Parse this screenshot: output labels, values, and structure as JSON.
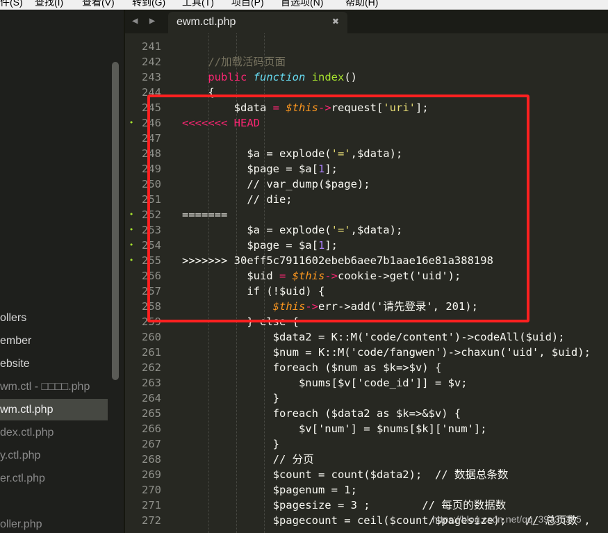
{
  "menubar": {
    "items": [
      "件(S)",
      "查找(I)",
      "查看(V)",
      "转到(G)",
      "工具(T)",
      "项目(P)",
      "首选项(N)",
      "帮助(H)"
    ]
  },
  "sidebar": {
    "items": [
      {
        "label": "ollers"
      },
      {
        "label": "ember"
      },
      {
        "label": "ebsite"
      },
      {
        "label": "wm.ctl - □□□□.php"
      },
      {
        "label": "wm.ctl.php"
      },
      {
        "label": "dex.ctl.php"
      },
      {
        "label": "y.ctl.php"
      },
      {
        "label": "er.ctl.php"
      },
      {
        "label": "oller.php"
      }
    ]
  },
  "tab": {
    "nav": "◀ ▶",
    "title": "ewm.ctl.php",
    "close": "✖"
  },
  "editor": {
    "line_numbers": [
      "241",
      "242",
      "243",
      "244",
      "245",
      "246",
      "247",
      "248",
      "249",
      "250",
      "251",
      "252",
      "253",
      "254",
      "255",
      "256",
      "257",
      "258",
      "259",
      "260",
      "261",
      "262",
      "263",
      "264",
      "265",
      "266",
      "267",
      "268",
      "269",
      "270",
      "271",
      "272"
    ],
    "modified_marks": [
      "",
      "",
      "",
      "",
      "",
      "•",
      "",
      "",
      "",
      "",
      "",
      "•",
      "•",
      "•",
      "•",
      "",
      "",
      "",
      "",
      "",
      "",
      "",
      "",
      "",
      "",
      "",
      "",
      "",
      "",
      "",
      "",
      ""
    ],
    "lines": [
      [],
      [
        [
          "c",
          "    //加载活码页面"
        ]
      ],
      [
        [
          "p",
          "    "
        ],
        [
          "k",
          "public"
        ],
        [
          "p",
          " "
        ],
        [
          "s",
          "function"
        ],
        [
          "p",
          " "
        ],
        [
          "f",
          "index"
        ],
        [
          "p",
          "()"
        ]
      ],
      [
        [
          "p",
          "    {"
        ]
      ],
      [
        [
          "p",
          "        $data "
        ],
        [
          "o",
          "="
        ],
        [
          "p",
          " "
        ],
        [
          "t",
          "$this"
        ],
        [
          "o",
          "->"
        ],
        [
          "p",
          "request["
        ],
        [
          "q",
          "'uri'"
        ],
        [
          "p",
          "];"
        ]
      ],
      [
        [
          "x",
          "<<<<<<< HEAD"
        ]
      ],
      [],
      [
        [
          "p",
          "          $a = explode("
        ],
        [
          "q",
          "'='"
        ],
        [
          "p",
          ",$data);"
        ]
      ],
      [
        [
          "p",
          "          $page = $a["
        ],
        [
          "n",
          "1"
        ],
        [
          "p",
          "];"
        ]
      ],
      [
        [
          "p",
          "          // var_dump($page);"
        ]
      ],
      [
        [
          "p",
          "          // die;"
        ]
      ],
      [
        [
          "p",
          "======="
        ]
      ],
      [
        [
          "p",
          "          $a = explode("
        ],
        [
          "q",
          "'='"
        ],
        [
          "p",
          ",$data);"
        ]
      ],
      [
        [
          "p",
          "          $page = $a["
        ],
        [
          "n",
          "1"
        ],
        [
          "p",
          "];"
        ]
      ],
      [
        [
          "p",
          ">>>>>>> 30eff5c7911602ebeb6aee7b1aae16e81a388198"
        ]
      ],
      [
        [
          "p",
          "          $uid "
        ],
        [
          "o",
          "="
        ],
        [
          "p",
          " "
        ],
        [
          "t",
          "$this"
        ],
        [
          "o",
          "->"
        ],
        [
          "p",
          "cookie->get('uid');"
        ]
      ],
      [
        [
          "p",
          "          if (!$uid) {"
        ]
      ],
      [
        [
          "p",
          "              "
        ],
        [
          "t",
          "$this"
        ],
        [
          "o",
          "->"
        ],
        [
          "p",
          "err->add('请先登录', 201);"
        ]
      ],
      [
        [
          "p",
          "          } else {"
        ]
      ],
      [
        [
          "p",
          "              $data2 = K::M('code/content')->codeAll($uid);"
        ]
      ],
      [
        [
          "p",
          "              $num = K::M('code/fangwen')->chaxun('uid', $uid);"
        ]
      ],
      [
        [
          "p",
          "              foreach ($num as $k=>$v) {"
        ]
      ],
      [
        [
          "p",
          "                  $nums[$v['code_id']] = $v;"
        ]
      ],
      [
        [
          "p",
          "              }"
        ]
      ],
      [
        [
          "p",
          "              foreach ($data2 as $k=>&$v) {"
        ]
      ],
      [
        [
          "p",
          "                  $v['num'] = $nums[$k]['num'];"
        ]
      ],
      [
        [
          "p",
          "              }"
        ]
      ],
      [
        [
          "p",
          "              // 分页"
        ]
      ],
      [
        [
          "p",
          "              $count = count($data2);  // 数据总条数"
        ]
      ],
      [
        [
          "p",
          "              $pagenum = 1;"
        ]
      ],
      [
        [
          "p",
          "              $pagesize = 3 ;        // 每页的数据数"
        ]
      ],
      [
        [
          "p",
          "              $pagecount = ceil($count/$pagesize);   // 总页数 ,"
        ]
      ]
    ]
  },
  "watermark": "https://blog.csdn.net/qq_39335305",
  "colors": {
    "background": "#272822",
    "sidebar": "#1e1f1c",
    "highlight_box": "#ff2020",
    "keyword": "#f92672",
    "function": "#a6e22e",
    "storage": "#66d9ef",
    "string": "#e6db74",
    "comment": "#75715e",
    "number": "#ae81ff",
    "this": "#fd971f"
  }
}
